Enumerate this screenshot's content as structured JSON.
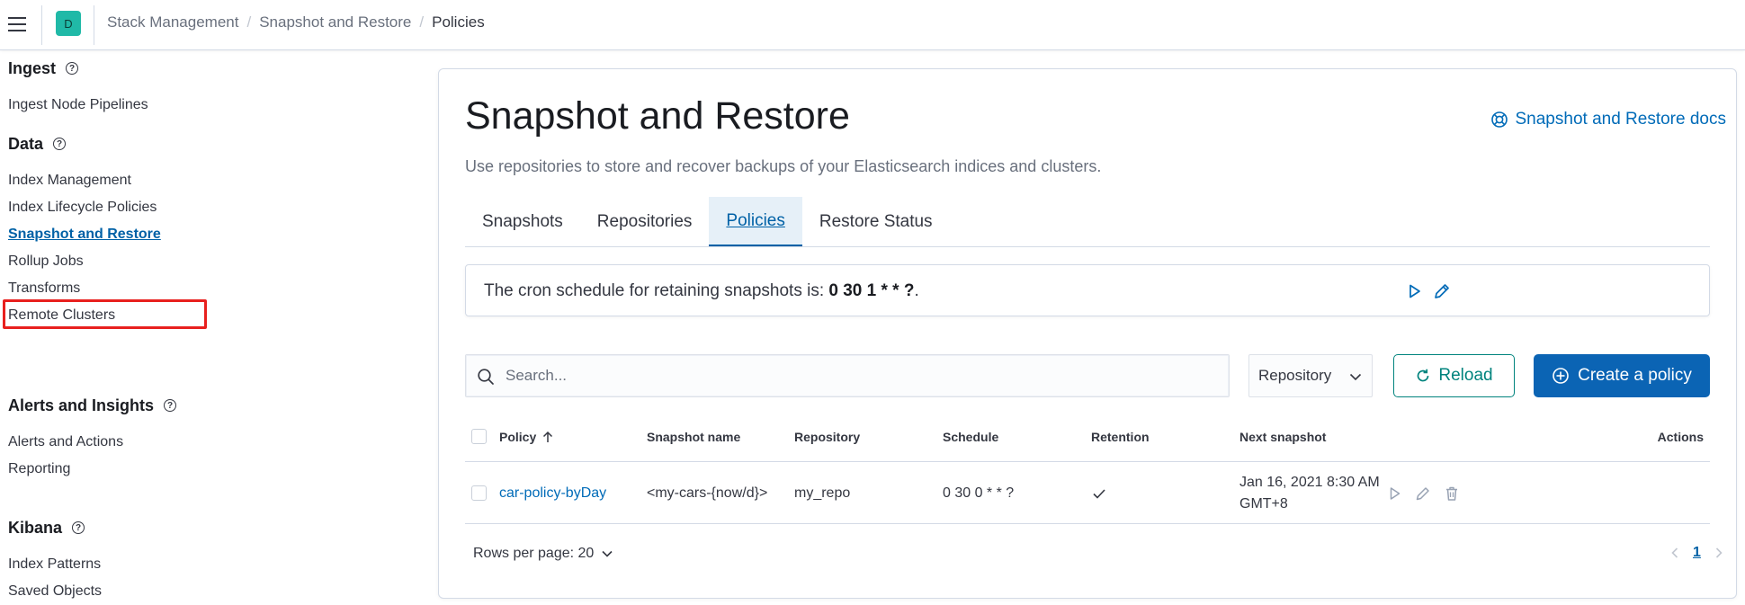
{
  "header": {
    "space_initial": "D",
    "breadcrumbs": [
      "Stack Management",
      "Snapshot and Restore",
      "Policies"
    ]
  },
  "sidebar": {
    "groups": [
      {
        "title": "Ingest",
        "items": [
          "Ingest Node Pipelines"
        ]
      },
      {
        "title": "Data",
        "items": [
          "Index Management",
          "Index Lifecycle Policies",
          "Snapshot and Restore",
          "Rollup Jobs",
          "Transforms",
          "Remote Clusters"
        ]
      },
      {
        "title": "Alerts and Insights",
        "items": [
          "Alerts and Actions",
          "Reporting"
        ]
      },
      {
        "title": "Kibana",
        "items": [
          "Index Patterns",
          "Saved Objects"
        ]
      }
    ],
    "active_item": "Snapshot and Restore"
  },
  "main": {
    "title": "Snapshot and Restore",
    "docs_link": "Snapshot and Restore docs",
    "description": "Use repositories to store and recover backups of your Elasticsearch indices and clusters.",
    "tabs": [
      "Snapshots",
      "Repositories",
      "Policies",
      "Restore Status"
    ],
    "selected_tab": "Policies",
    "cron_prefix": "The cron schedule for retaining snapshots is: ",
    "cron_value": "0 30 1 * * ?",
    "cron_suffix": ".",
    "search_placeholder": "Search...",
    "repository_filter": "Repository",
    "reload_label": "Reload",
    "create_label": "Create a policy",
    "table": {
      "columns": [
        "Policy",
        "Snapshot name",
        "Repository",
        "Schedule",
        "Retention",
        "Next snapshot",
        "Actions"
      ],
      "rows": [
        {
          "policy": "car-policy-byDay",
          "snapshot_name": "<my-cars-{now/d}>",
          "repository": "my_repo",
          "schedule": "0 30 0 * * ?",
          "retention": "check",
          "next_snapshot_line1": "Jan 16, 2021 8:30 AM",
          "next_snapshot_line2": "GMT+8"
        }
      ]
    },
    "rows_per_page": "Rows per page: 20",
    "current_page": "1"
  },
  "colors": {
    "accent": "#0061a6",
    "primary_button": "#0b64b4",
    "reload_button": "#00837d",
    "highlight_box": "#e8201e",
    "space_avatar": "#20b9a7"
  }
}
